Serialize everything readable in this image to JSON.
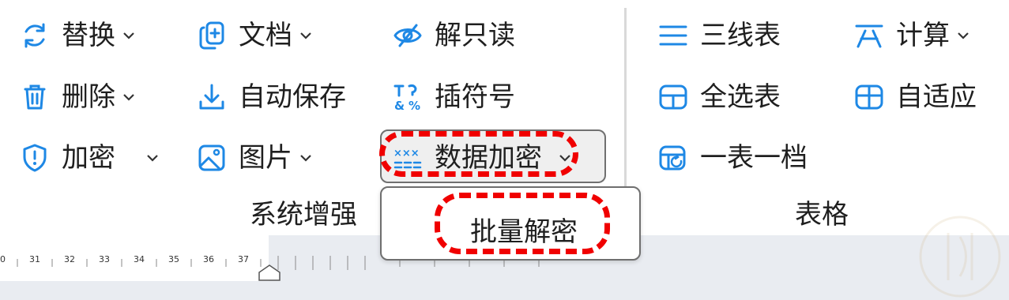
{
  "ribbon": {
    "col1": [
      {
        "label": "替换",
        "icon": "refresh-icon"
      },
      {
        "label": "删除",
        "icon": "trash-icon"
      },
      {
        "label": "加密",
        "icon": "shield-icon"
      }
    ],
    "col2": [
      {
        "label": "文档",
        "icon": "document-add-icon"
      },
      {
        "label": "自动保存",
        "icon": "download-icon"
      },
      {
        "label": "图片",
        "icon": "image-icon"
      }
    ],
    "col3": [
      {
        "label": "解只读",
        "icon": "eye-off-icon"
      },
      {
        "label": "插符号",
        "icon": "symbol-icon"
      },
      {
        "label": "数据加密",
        "icon": "data-encrypt-icon"
      }
    ],
    "col4": [
      {
        "label": "三线表",
        "icon": "lines-icon"
      },
      {
        "label": "全选表",
        "icon": "table-icon"
      },
      {
        "label": "一表一档",
        "icon": "table-refresh-icon"
      }
    ],
    "col5": [
      {
        "label": "计算",
        "icon": "calculate-icon"
      },
      {
        "label": "自适应",
        "icon": "table-fit-icon"
      }
    ],
    "groups": {
      "system": "系统增强",
      "table": "表格"
    }
  },
  "dropdown": {
    "items": [
      "批量解密"
    ]
  },
  "ruler": {
    "labels": [
      "0",
      "31",
      "32",
      "33",
      "34",
      "35",
      "36",
      "37"
    ]
  },
  "colors": {
    "accent": "#1e88e5",
    "annotation": "#f00000"
  }
}
